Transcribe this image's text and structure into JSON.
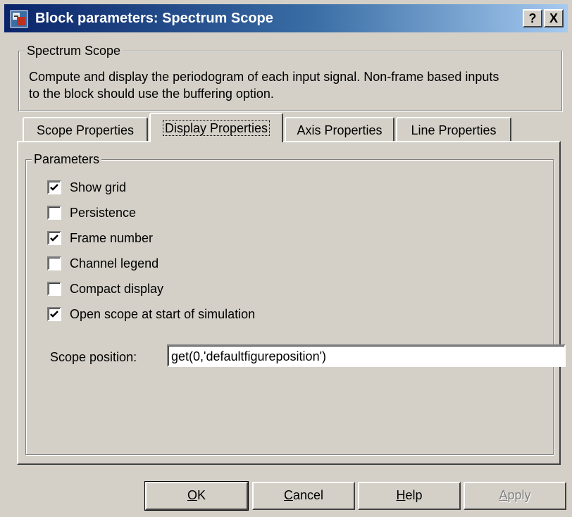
{
  "window": {
    "title": "Block parameters: Spectrum Scope",
    "help_glyph": "?",
    "close_glyph": "X"
  },
  "description_group": {
    "title": "Spectrum Scope",
    "text_line1": "Compute and display the periodogram of each input signal.  Non-frame based inputs",
    "text_line2": "to the block should use the buffering option."
  },
  "tabs": [
    {
      "label": "Scope Properties",
      "active": false
    },
    {
      "label": "Display Properties",
      "active": true
    },
    {
      "label": "Axis Properties",
      "active": false
    },
    {
      "label": "Line Properties",
      "active": false
    }
  ],
  "parameters": {
    "title": "Parameters",
    "checkboxes": [
      {
        "label": "Show grid",
        "checked": true
      },
      {
        "label": "Persistence",
        "checked": false
      },
      {
        "label": "Frame number",
        "checked": true
      },
      {
        "label": "Channel legend",
        "checked": false
      },
      {
        "label": "Compact display",
        "checked": false
      },
      {
        "label": "Open scope at start of simulation",
        "checked": true
      }
    ],
    "scope_position_label": "Scope position:",
    "scope_position_value": "get(0,'defaultfigureposition')"
  },
  "buttons": {
    "ok": {
      "underlined": "O",
      "rest": "K"
    },
    "cancel": {
      "underlined": "C",
      "rest": "ancel"
    },
    "help": {
      "underlined": "H",
      "rest": "elp"
    },
    "apply": {
      "underlined": "A",
      "rest": "pply",
      "disabled": true
    }
  },
  "icons": {
    "app": "block-parameters-icon",
    "check": "checkmark-icon"
  },
  "colors": {
    "titlebar_start": "#0a246a",
    "titlebar_end": "#a6caf0",
    "face": "#d4d0c8"
  }
}
